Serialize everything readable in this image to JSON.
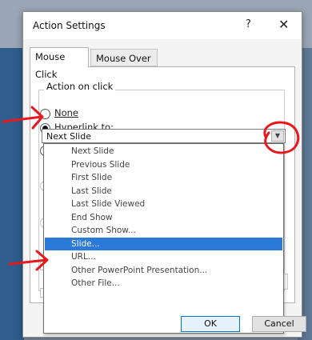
{
  "dialog": {
    "title": "Action Settings",
    "help_label": "?",
    "close_label": "✕",
    "tabs": [
      {
        "label": "Mouse Click",
        "active": true
      },
      {
        "label": "Mouse Over",
        "active": false
      }
    ],
    "group_label": "Action on click",
    "options": [
      {
        "label": "None",
        "checked": false
      },
      {
        "label": "Hyperlink to:",
        "checked": true
      }
    ],
    "hyperlink_value": "Next Slide",
    "dropdown_items": [
      "Next Slide",
      "Previous Slide",
      "First Slide",
      "Last Slide",
      "Last Slide Viewed",
      "End Show",
      "Custom Show...",
      "Slide...",
      "URL...",
      "Other PowerPoint Presentation...",
      "Other File..."
    ],
    "selected_item": "Slide...",
    "partially_hidden_label": "Hi",
    "ok_label": "OK",
    "cancel_label": "Cancel"
  },
  "colors": {
    "selection": "#2b79d8",
    "annotation": "#e8191e"
  }
}
